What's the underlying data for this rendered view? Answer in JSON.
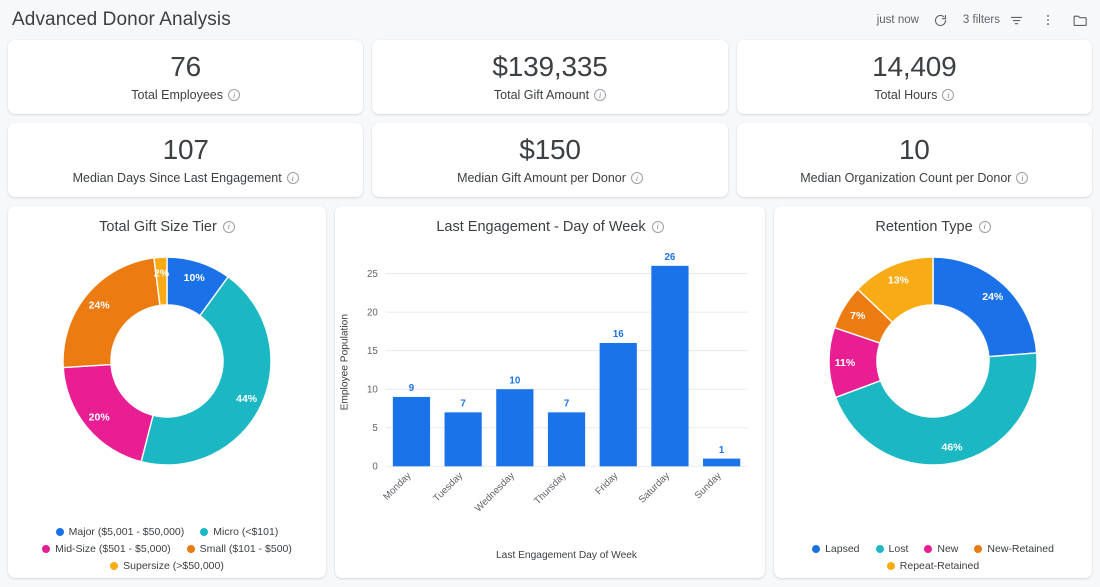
{
  "header": {
    "title": "Advanced Donor Analysis",
    "refresh_status": "just now",
    "refresh_icon": "refresh-icon",
    "filters_label": "3 filters",
    "filter_icon": "filter-icon",
    "more_icon": "more-vertical-icon",
    "folder_icon": "folder-icon"
  },
  "kpis": [
    {
      "value": "76",
      "label": "Total Employees"
    },
    {
      "value": "$139,335",
      "label": "Total Gift Amount"
    },
    {
      "value": "14,409",
      "label": "Total Hours"
    },
    {
      "value": "107",
      "label": "Median Days Since Last Engagement"
    },
    {
      "value": "$150",
      "label": "Median Gift Amount per Donor"
    },
    {
      "value": "10",
      "label": "Median Organization Count per Donor"
    }
  ],
  "colors": {
    "blue": "#1b72e8",
    "teal": "#1bb8c4",
    "pink": "#e91e93",
    "orange": "#ec7c12",
    "yellow": "#f9ab16",
    "bar": "#1a73e8",
    "grid": "#e8eaed",
    "text": "#3c4043"
  },
  "chart_data": [
    {
      "type": "pie",
      "title": "Total Gift Size Tier",
      "panel": "total-gift-size-tier",
      "categories": [
        "Major ($5,001 - $50,000)",
        "Micro (<$101)",
        "Mid-Size ($501 - $5,000)",
        "Small ($101 - $500)",
        "Supersize (>$50,000)"
      ],
      "values": [
        10,
        44,
        20,
        24,
        2
      ],
      "labels": [
        "10%",
        "44%",
        "20%",
        "24%",
        "2%"
      ],
      "colors": [
        "#1b72e8",
        "#1bb8c4",
        "#e91e93",
        "#ec7c12",
        "#f9ab16"
      ],
      "legend_order": [
        "Major ($5,001 - $50,000)",
        "Micro (<$101)",
        "Mid-Size ($501 - $5,000)",
        "Small ($101 - $500)",
        "Supersize (>$50,000)"
      ],
      "legend_colors": [
        "#1b72e8",
        "#1bb8c4",
        "#e91e93",
        "#ec7c12",
        "#f9ab16"
      ],
      "legend_position": "bottom",
      "donut": true
    },
    {
      "type": "bar",
      "title": "Last Engagement - Day of Week",
      "panel": "last-engagement-day-of-week",
      "categories": [
        "Monday",
        "Tuesday",
        "Wednesday",
        "Thursday",
        "Friday",
        "Saturday",
        "Sunday"
      ],
      "values": [
        9,
        7,
        10,
        7,
        16,
        26,
        1
      ],
      "xlabel": "Last Engagement Day of Week",
      "ylabel": "Employee Population",
      "yticks": [
        0,
        5,
        10,
        15,
        20,
        25
      ],
      "ylim": [
        0,
        27
      ],
      "grid": true,
      "color": "#1a73e8"
    },
    {
      "type": "pie",
      "title": "Retention Type",
      "panel": "retention-type",
      "categories": [
        "Lapsed",
        "Lost",
        "New",
        "New-Retained",
        "Repeat-Retained"
      ],
      "values": [
        24,
        46,
        11,
        7,
        13
      ],
      "labels": [
        "24%",
        "46%",
        "11%",
        "7%",
        "13%"
      ],
      "colors": [
        "#1b72e8",
        "#1bb8c4",
        "#e91e93",
        "#ec7c12",
        "#f9ab16"
      ],
      "legend_order": [
        "Lapsed",
        "Lost",
        "New",
        "New-Retained",
        "Repeat-Retained"
      ],
      "legend_colors": [
        "#1b72e8",
        "#1bb8c4",
        "#e91e93",
        "#ec7c12",
        "#f9ab16"
      ],
      "legend_position": "bottom",
      "donut": true
    }
  ]
}
